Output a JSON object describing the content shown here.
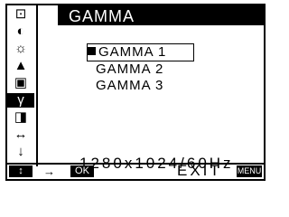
{
  "menu": {
    "title": "GAMMA"
  },
  "icons": [
    {
      "name": "input-icon",
      "glyph": "⊡"
    },
    {
      "name": "contrast-icon",
      "glyph": "◐"
    },
    {
      "name": "brightness-icon",
      "glyph": "☼"
    },
    {
      "name": "sharpness-icon",
      "glyph": "▲"
    },
    {
      "name": "color-icon",
      "glyph": "▣"
    },
    {
      "name": "gamma-icon",
      "glyph": "γ"
    },
    {
      "name": "size-icon",
      "glyph": "◨"
    },
    {
      "name": "center-icon",
      "glyph": "↔"
    },
    {
      "name": "more-icon",
      "glyph": "↓"
    }
  ],
  "options": [
    "GAMMA 1",
    "GAMMA 2",
    "GAMMA 3"
  ],
  "selected_option": "GAMMA 1",
  "status": {
    "resolution": "1280x1024/60Hz"
  },
  "footer": {
    "nav_glyphs": "↕",
    "arrow": "→",
    "ok_label": "OK",
    "exit_label": "EXIT",
    "menu_label": "MENU"
  }
}
